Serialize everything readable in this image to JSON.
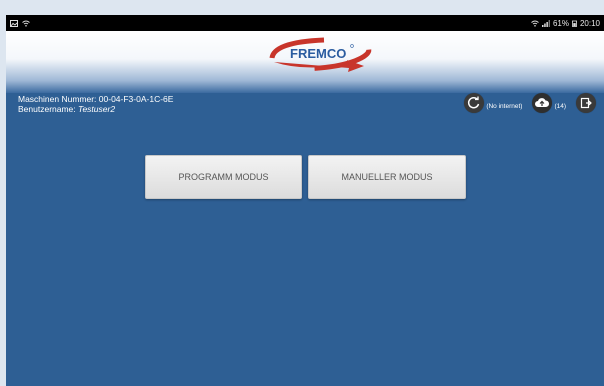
{
  "statusbar": {
    "time": "20:10",
    "battery": "61%"
  },
  "header": {
    "logo_text": "FREMCO"
  },
  "info": {
    "machine_label": "Maschinen Nummer:",
    "machine_value": "00-04-F3-0A-1C-6E",
    "user_label": "Benutzername:",
    "user_value": "Testuser2"
  },
  "actions": {
    "sync_label": "(No internet)",
    "upload_count": "(14)"
  },
  "buttons": {
    "program_mode": "PROGRAMM MODUS",
    "manual_mode": "MANUELLER MODUS"
  },
  "colors": {
    "background": "#2e5f94",
    "logo_red": "#c8352b",
    "logo_blue": "#2a5ca0"
  }
}
